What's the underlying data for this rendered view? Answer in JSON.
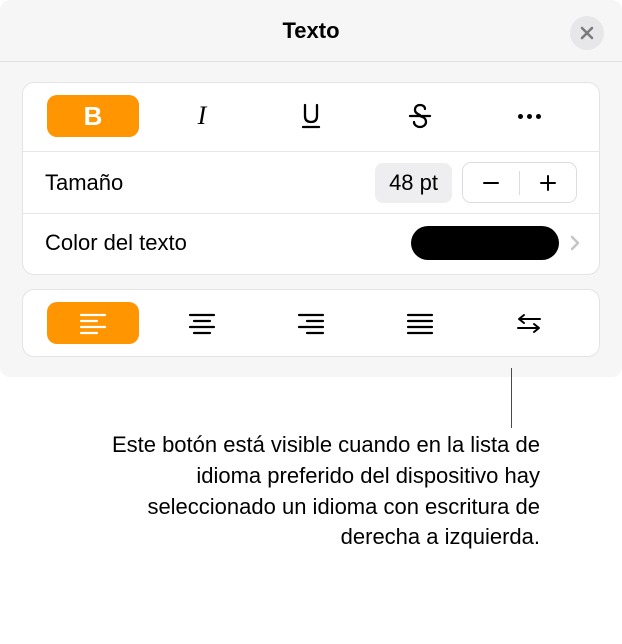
{
  "header": {
    "title": "Texto"
  },
  "size": {
    "label": "Tamaño",
    "value": "48 pt"
  },
  "color": {
    "label": "Color del texto",
    "value": "#000000"
  },
  "callout": "Este botón está visible cuando en la lista de idioma preferido del dispositivo hay seleccionado un idioma con escritura de derecha a izquierda."
}
